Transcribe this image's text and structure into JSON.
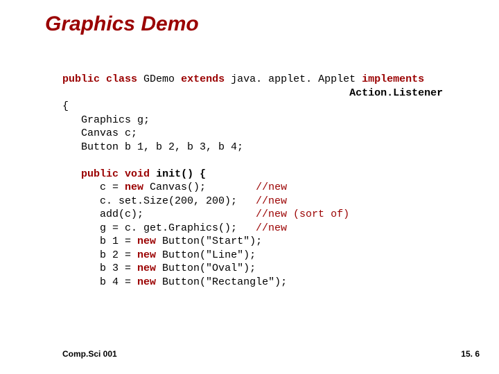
{
  "title": "Graphics Demo",
  "code": {
    "kw_public": "public",
    "kw_class": "class",
    "kw_extends": "extends",
    "kw_implements": "implements",
    "gdemo": " GDemo ",
    "applet": " java. applet. Applet ",
    "actionlistener": "Action.Listener",
    "open_brace": "{",
    "field_g": "   Graphics g;",
    "field_c": "   Canvas c;",
    "field_b": "   Button b 1, b 2, b 3, b 4;",
    "kw_void": "void",
    "init_sig_pre": "   ",
    "init_sig_mid": " init() {",
    "l_c_new_pre": "      c = ",
    "kw_new": "new",
    "l_c_new_post": " Canvas();        ",
    "cm_new1": "//new",
    "l_setsize": "      c. set.Size(200, 200);   ",
    "cm_new2": "//new",
    "l_addc": "      add(c);                  ",
    "cm_new3": "//new (sort of)",
    "l_getg": "      g = c. get.Graphics();   ",
    "cm_new4": "//new",
    "l_b1_pre": "      b 1 = ",
    "l_b1_post": " Button(\"Start\");",
    "l_b2_pre": "      b 2 = ",
    "l_b2_post": " Button(\"Line\");",
    "l_b3_pre": "      b 3 = ",
    "l_b3_post": " Button(\"Oval\");",
    "l_b4_pre": "      b 4 = ",
    "l_b4_post": " Button(\"Rectangle\");"
  },
  "footer": {
    "left": "Comp.Sci 001",
    "right": "15. 6"
  }
}
